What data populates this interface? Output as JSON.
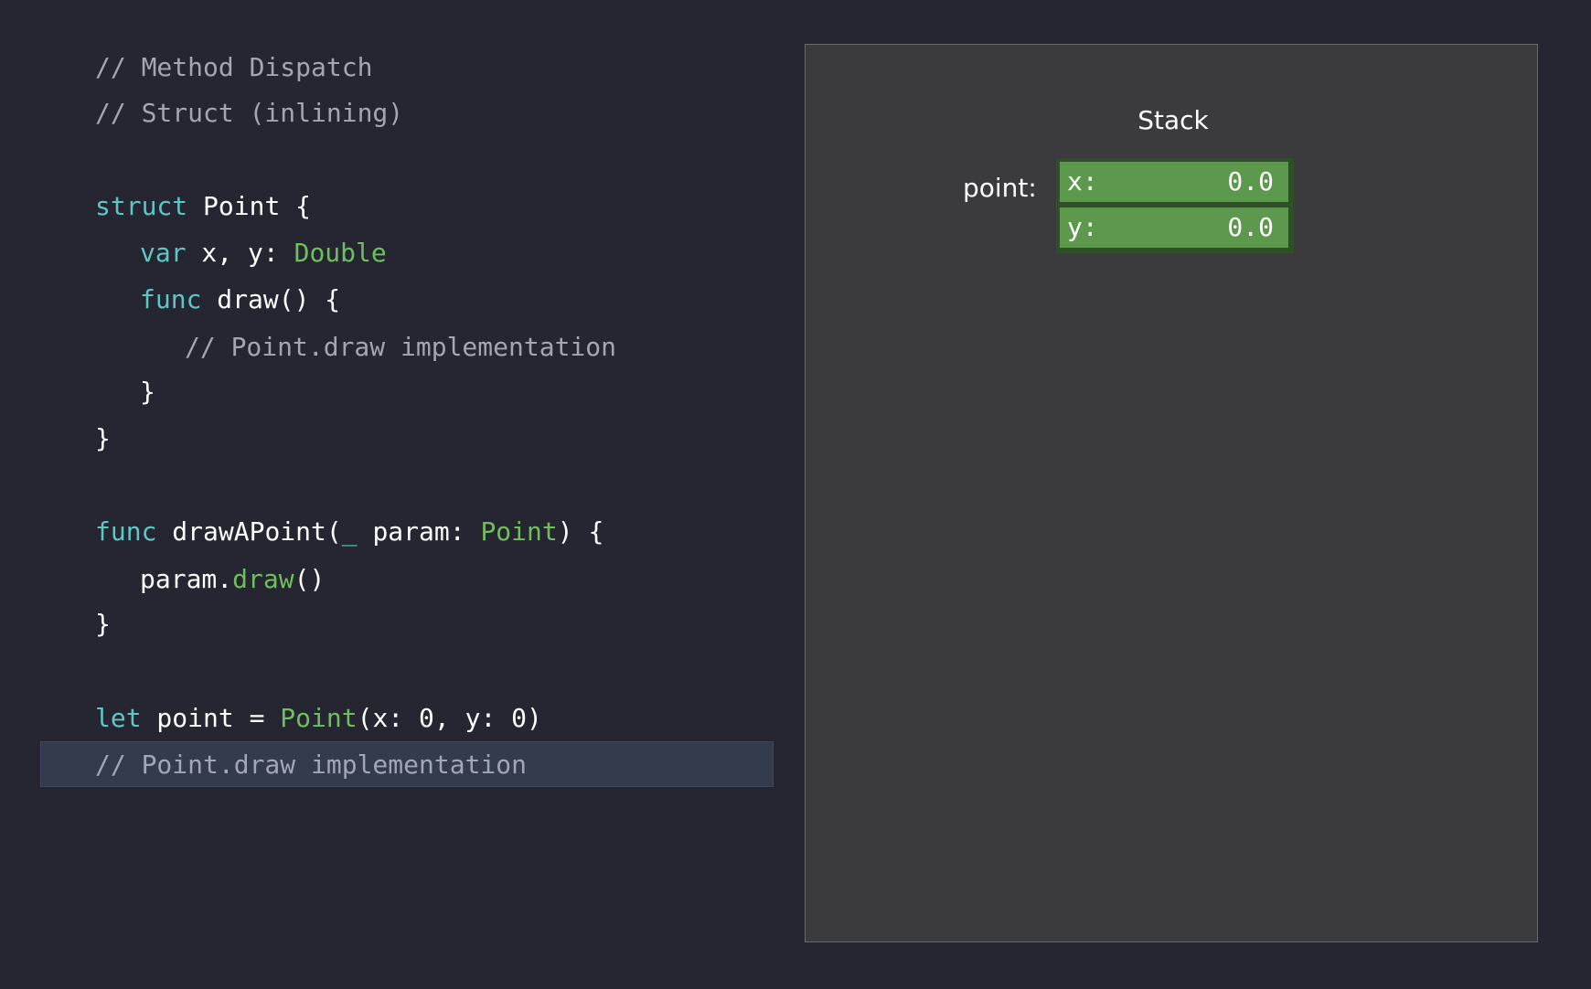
{
  "code": {
    "lines": [
      [
        {
          "t": "// Method Dispatch",
          "c": "comment"
        }
      ],
      [
        {
          "t": "// Struct (inlining)",
          "c": "comment"
        }
      ],
      [
        {
          "t": "struct",
          "c": "keyword"
        },
        {
          "t": " Point {",
          "c": "plain"
        }
      ],
      [
        {
          "t": "var",
          "c": "keyword"
        },
        {
          "t": " x, y: ",
          "c": "plain"
        },
        {
          "t": "Double",
          "c": "type"
        }
      ],
      [
        {
          "t": "func",
          "c": "keyword"
        },
        {
          "t": " draw() {",
          "c": "plain"
        }
      ],
      [
        {
          "t": "// Point.draw implementation",
          "c": "comment"
        }
      ],
      [
        {
          "t": "}",
          "c": "plain"
        }
      ],
      [
        {
          "t": "}",
          "c": "plain"
        }
      ],
      [
        {
          "t": "func",
          "c": "keyword"
        },
        {
          "t": " drawAPoint(",
          "c": "plain"
        },
        {
          "t": "_",
          "c": "keyword"
        },
        {
          "t": " param: ",
          "c": "plain"
        },
        {
          "t": "Point",
          "c": "type"
        },
        {
          "t": ") {",
          "c": "plain"
        }
      ],
      [
        {
          "t": "param.",
          "c": "plain"
        },
        {
          "t": "draw",
          "c": "type"
        },
        {
          "t": "()",
          "c": "plain"
        }
      ],
      [
        {
          "t": "}",
          "c": "plain"
        }
      ],
      [
        {
          "t": "let",
          "c": "keyword"
        },
        {
          "t": " point = ",
          "c": "plain"
        },
        {
          "t": "Point",
          "c": "type"
        },
        {
          "t": "(x: 0, y: 0)",
          "c": "plain"
        }
      ],
      [
        {
          "t": "// Point.draw implementation",
          "c": "comment"
        }
      ]
    ],
    "highlighted_line": 12
  },
  "stack": {
    "title": "Stack",
    "variable_label": "point:",
    "fields": [
      {
        "name": "x:",
        "value": "0.0"
      },
      {
        "name": "y:",
        "value": "0.0"
      }
    ]
  },
  "colors": {
    "background": "#252631",
    "comment": "#a3a6b3",
    "keyword": "#5ec6c5",
    "type": "#6fbf5e",
    "plain": "#ffffff",
    "panel": "#3b3b3d",
    "field_fill": "#5c994c",
    "field_border": "#2e4f28",
    "highlight": "#333b4d"
  }
}
